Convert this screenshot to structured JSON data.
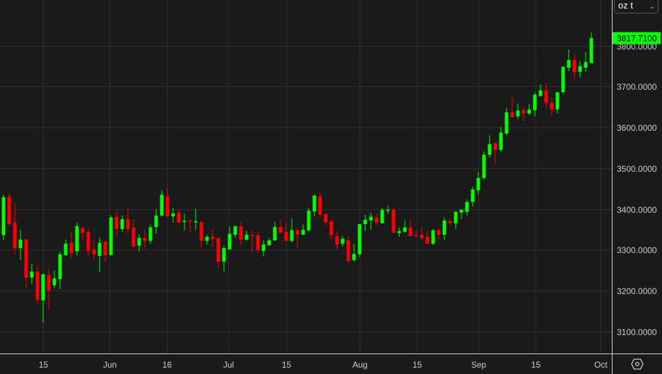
{
  "unit_selector": {
    "value": "oz t",
    "icon": "chevron-down-icon"
  },
  "settings_icon": "gear-hexagon-icon",
  "colors": {
    "background": "#1a1a1a",
    "up": "#00ff00",
    "down": "#ff0000",
    "grid": "#2e2e2e",
    "axis_text": "#cccccc",
    "last_price_bg": "#00ff00"
  },
  "chart_data": {
    "type": "candlestick",
    "title": "",
    "xlabel": "",
    "ylabel": "",
    "ylim": [
      3046,
      3912
    ],
    "grid": true,
    "y_ticks": [
      {
        "value": 3800,
        "label": "3800.0000"
      },
      {
        "value": 3700,
        "label": "3700.0000"
      },
      {
        "value": 3600,
        "label": "3600.0000"
      },
      {
        "value": 3500,
        "label": "3500.0000"
      },
      {
        "value": 3400,
        "label": "3400.0000"
      },
      {
        "value": 3300,
        "label": "3300.0000"
      },
      {
        "value": 3200,
        "label": "3200.0000"
      },
      {
        "value": 3100,
        "label": "3100.0000"
      }
    ],
    "x_ticks": [
      {
        "index": 7,
        "label": "15"
      },
      {
        "index": 18.8,
        "label": "Jun"
      },
      {
        "index": 28.9,
        "label": "16"
      },
      {
        "index": 39.7,
        "label": "Jul"
      },
      {
        "index": 50,
        "label": "15"
      },
      {
        "index": 63,
        "label": "Aug"
      },
      {
        "index": 73.1,
        "label": "15"
      },
      {
        "index": 84,
        "label": "Sep"
      },
      {
        "index": 94.1,
        "label": "15"
      },
      {
        "index": 105.6,
        "label": "Oct"
      }
    ],
    "last_price": {
      "value": 3817.71,
      "label": "3817.7100"
    },
    "ohlc_fields": [
      "open",
      "high",
      "low",
      "close"
    ],
    "ohlc": [
      [
        3336,
        3436,
        3323,
        3429
      ],
      [
        3431,
        3438,
        3358,
        3363
      ],
      [
        3367,
        3415,
        3289,
        3304
      ],
      [
        3304,
        3348,
        3275,
        3325
      ],
      [
        3325,
        3327,
        3207,
        3232
      ],
      [
        3232,
        3266,
        3216,
        3247
      ],
      [
        3247,
        3258,
        3167,
        3178
      ],
      [
        3176,
        3242,
        3121,
        3240
      ],
      [
        3238,
        3252,
        3154,
        3200
      ],
      [
        3213,
        3249,
        3206,
        3230
      ],
      [
        3228,
        3296,
        3204,
        3289
      ],
      [
        3287,
        3325,
        3285,
        3315
      ],
      [
        3317,
        3346,
        3280,
        3292
      ],
      [
        3296,
        3367,
        3287,
        3358
      ],
      [
        3353,
        3356,
        3323,
        3341
      ],
      [
        3344,
        3353,
        3285,
        3297
      ],
      [
        3301,
        3325,
        3277,
        3289
      ],
      [
        3285,
        3330,
        3245,
        3317
      ],
      [
        3320,
        3323,
        3271,
        3287
      ],
      [
        3287,
        3384,
        3287,
        3379
      ],
      [
        3381,
        3393,
        3334,
        3351
      ],
      [
        3351,
        3384,
        3344,
        3375
      ],
      [
        3375,
        3403,
        3339,
        3351
      ],
      [
        3355,
        3375,
        3306,
        3308
      ],
      [
        3310,
        3339,
        3296,
        3329
      ],
      [
        3329,
        3349,
        3303,
        3322
      ],
      [
        3322,
        3362,
        3315,
        3355
      ],
      [
        3356,
        3400,
        3339,
        3384
      ],
      [
        3384,
        3446,
        3381,
        3435
      ],
      [
        3431,
        3452,
        3381,
        3382
      ],
      [
        3382,
        3403,
        3367,
        3389
      ],
      [
        3391,
        3400,
        3363,
        3367
      ],
      [
        3369,
        3388,
        3348,
        3371
      ],
      [
        3371,
        3375,
        3342,
        3369
      ],
      [
        3368,
        3400,
        3349,
        3370
      ],
      [
        3368,
        3372,
        3306,
        3322
      ],
      [
        3322,
        3337,
        3313,
        3332
      ],
      [
        3332,
        3349,
        3308,
        3327
      ],
      [
        3329,
        3329,
        3256,
        3271
      ],
      [
        3271,
        3310,
        3247,
        3304
      ],
      [
        3301,
        3358,
        3301,
        3339
      ],
      [
        3337,
        3358,
        3329,
        3358
      ],
      [
        3358,
        3367,
        3311,
        3325
      ],
      [
        3325,
        3346,
        3322,
        3337
      ],
      [
        3336,
        3346,
        3294,
        3335
      ],
      [
        3336,
        3346,
        3294,
        3299
      ],
      [
        3297,
        3323,
        3284,
        3313
      ],
      [
        3311,
        3329,
        3310,
        3323
      ],
      [
        3323,
        3368,
        3322,
        3356
      ],
      [
        3356,
        3375,
        3341,
        3342
      ],
      [
        3344,
        3367,
        3320,
        3322
      ],
      [
        3322,
        3377,
        3318,
        3348
      ],
      [
        3348,
        3353,
        3306,
        3337
      ],
      [
        3337,
        3362,
        3336,
        3349
      ],
      [
        3348,
        3403,
        3344,
        3396
      ],
      [
        3394,
        3435,
        3382,
        3433
      ],
      [
        3431,
        3440,
        3379,
        3386
      ],
      [
        3388,
        3388,
        3360,
        3367
      ],
      [
        3370,
        3374,
        3325,
        3336
      ],
      [
        3334,
        3346,
        3301,
        3313
      ],
      [
        3315,
        3334,
        3308,
        3327
      ],
      [
        3323,
        3332,
        3268,
        3273
      ],
      [
        3275,
        3315,
        3271,
        3290
      ],
      [
        3289,
        3363,
        3282,
        3363
      ],
      [
        3363,
        3386,
        3346,
        3374
      ],
      [
        3372,
        3391,
        3349,
        3381
      ],
      [
        3379,
        3388,
        3360,
        3367
      ],
      [
        3365,
        3403,
        3365,
        3398
      ],
      [
        3397,
        3408,
        3388,
        3398
      ],
      [
        3398,
        3405,
        3341,
        3342
      ],
      [
        3341,
        3355,
        3332,
        3346
      ],
      [
        3344,
        3372,
        3342,
        3355
      ],
      [
        3355,
        3375,
        3332,
        3334
      ],
      [
        3336,
        3349,
        3332,
        3335
      ],
      [
        3337,
        3356,
        3325,
        3329
      ],
      [
        3332,
        3346,
        3315,
        3315
      ],
      [
        3315,
        3351,
        3311,
        3348
      ],
      [
        3348,
        3353,
        3327,
        3337
      ],
      [
        3337,
        3379,
        3323,
        3372
      ],
      [
        3370,
        3377,
        3360,
        3365
      ],
      [
        3365,
        3395,
        3351,
        3393
      ],
      [
        3391,
        3400,
        3375,
        3398
      ],
      [
        3393,
        3424,
        3384,
        3417
      ],
      [
        3417,
        3455,
        3405,
        3448
      ],
      [
        3446,
        3490,
        3436,
        3476
      ],
      [
        3476,
        3542,
        3471,
        3533
      ],
      [
        3533,
        3580,
        3526,
        3559
      ],
      [
        3561,
        3563,
        3511,
        3545
      ],
      [
        3545,
        3601,
        3540,
        3587
      ],
      [
        3585,
        3648,
        3580,
        3637
      ],
      [
        3637,
        3675,
        3625,
        3625
      ],
      [
        3627,
        3658,
        3620,
        3641
      ],
      [
        3642,
        3649,
        3615,
        3634
      ],
      [
        3634,
        3658,
        3630,
        3644
      ],
      [
        3642,
        3686,
        3627,
        3680
      ],
      [
        3677,
        3705,
        3675,
        3691
      ],
      [
        3691,
        3708,
        3646,
        3660
      ],
      [
        3660,
        3673,
        3628,
        3644
      ],
      [
        3644,
        3686,
        3634,
        3686
      ],
      [
        3686,
        3750,
        3684,
        3748
      ],
      [
        3746,
        3791,
        3738,
        3765
      ],
      [
        3765,
        3781,
        3719,
        3736
      ],
      [
        3736,
        3762,
        3722,
        3750
      ],
      [
        3746,
        3784,
        3736,
        3760
      ],
      [
        3757,
        3833,
        3757,
        3819
      ]
    ]
  }
}
